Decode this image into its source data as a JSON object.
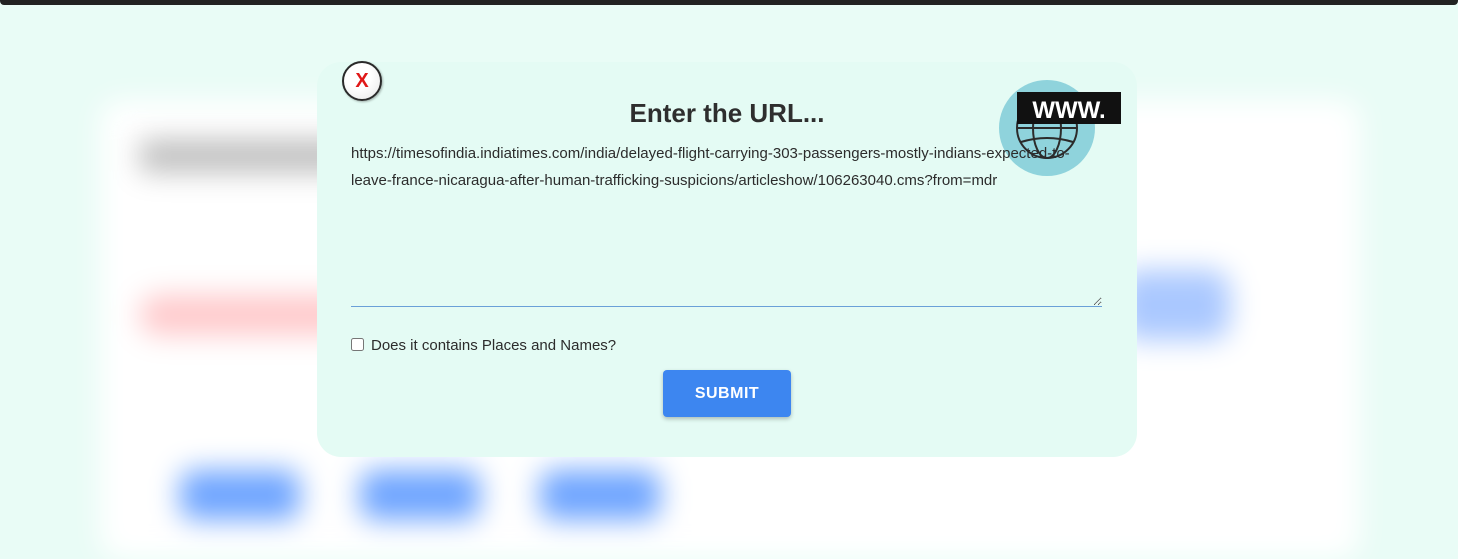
{
  "modal": {
    "close_label": "X",
    "title": "Enter the URL...",
    "url_value": "https://timesofindia.indiatimes.com/india/delayed-flight-carrying-303-passengers-mostly-indians-expected-to-leave-france-nicaragua-after-human-trafficking-suspicions/articleshow/106263040.cms?from=mdr",
    "logo_text": "WWW.",
    "checkbox_label": "Does it contains Places and Names?",
    "checkbox_checked": false,
    "submit_label": "SUBMIT"
  },
  "colors": {
    "page_background": "#e9fcf6",
    "modal_background": "#e4fbf4",
    "submit_button": "#3d86f0",
    "close_x": "#e01818"
  },
  "icons": [
    "close-icon",
    "www-globe-icon"
  ]
}
